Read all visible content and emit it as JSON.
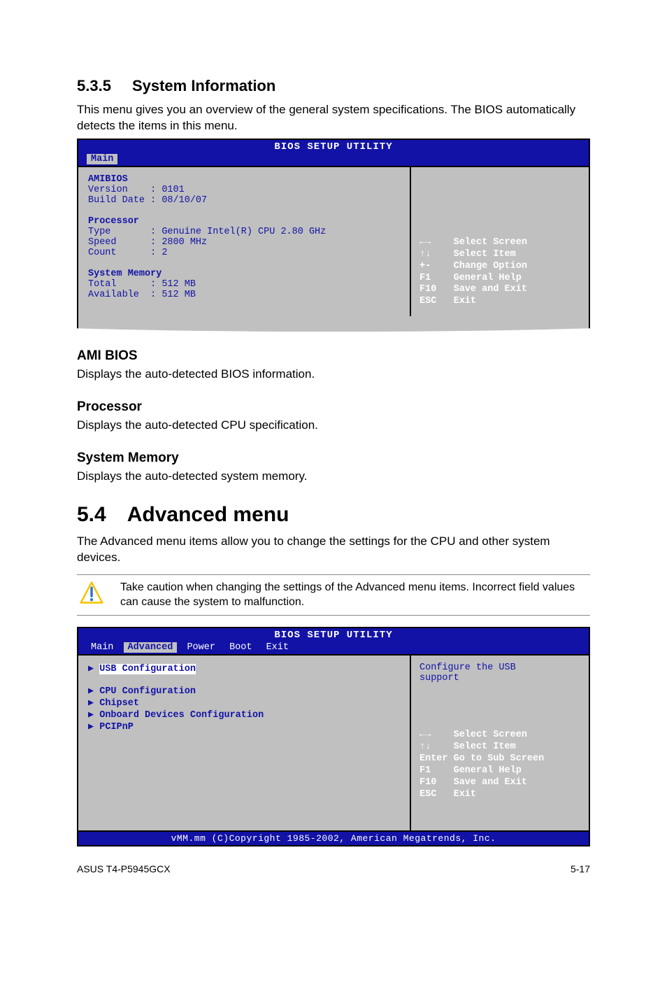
{
  "sec535": {
    "num": "5.3.5",
    "title": "System Information",
    "intro": "This menu gives you an overview of the general system specifications. The BIOS automatically detects the items in this menu."
  },
  "bios1": {
    "title": "BIOS SETUP UTILITY",
    "tab": "Main",
    "hdr_amibios": "AMIBIOS",
    "ver": "Version    : 0101",
    "bdate": "Build Date : 08/10/07",
    "hdr_proc": "Processor",
    "ptype": "Type       : Genuine Intel(R) CPU 2.80 GHz",
    "pspeed": "Speed      : 2800 MHz",
    "pcount": "Count      : 2",
    "hdr_mem": "System Memory",
    "mtotal": "Total      : 512 MB",
    "mavail": "Available  : 512 MB",
    "keys": "←→    Select Screen\n↑↓    Select Item\n+-    Change Option\nF1    General Help\nF10   Save and Exit\nESC   Exit"
  },
  "amibios": {
    "h": "AMI BIOS",
    "p": "Displays the auto-detected BIOS information."
  },
  "proc": {
    "h": "Processor",
    "p": "Displays the auto-detected CPU specification."
  },
  "mem": {
    "h": "System Memory",
    "p": "Displays the auto-detected system memory."
  },
  "sec54": {
    "num": "5.4",
    "title": "Advanced menu",
    "intro": "The Advanced menu items allow you to change the settings for the CPU and other system devices."
  },
  "caution": "Take caution when changing the settings of the Advanced menu items. Incorrect field values can cause the system to malfunction.",
  "bios2": {
    "title": "BIOS SETUP UTILITY",
    "tabs": {
      "main": "Main",
      "adv": "Advanced",
      "power": "Power",
      "boot": "Boot",
      "exit": "Exit"
    },
    "items": {
      "usb": "USB Configuration",
      "cpu": "CPU Configuration",
      "chip": "Chipset",
      "odc": "Onboard Devices Configuration",
      "pcipnp": "PCIPnP"
    },
    "help": "Configure the USB\nsupport",
    "keys": "←→    Select Screen\n↑↓    Select Item\nEnter Go to Sub Screen\nF1    General Help\nF10   Save and Exit\nESC   Exit",
    "footer": "vMM.mm (C)Copyright 1985-2002, American Megatrends, Inc."
  },
  "pagefooter": {
    "left": "ASUS T4-P5945GCX",
    "right": "5-17"
  }
}
